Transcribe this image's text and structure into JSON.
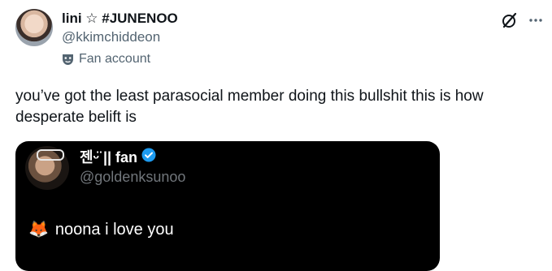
{
  "post": {
    "display_name": "lini ☆ #JUNENOO",
    "handle": "@kkimchiddeon",
    "label": "Fan account",
    "text": "you’ve got the least parasocial member doing this bullshit this is how desperate belift is"
  },
  "embedded": {
    "display_name": "젠ᵕ̈ || fan",
    "handle": "@goldenksunoo",
    "emoji": "🦊",
    "text": "noona i love you"
  },
  "icons": {
    "label_icon": "mask-icon",
    "grok": "grok-icon",
    "more": "more-icon",
    "verified": "verified-badge-icon"
  },
  "colors": {
    "text": "#0f1419",
    "secondary": "#536471",
    "verified": "#1d9bf0",
    "media_bg": "#000000"
  }
}
